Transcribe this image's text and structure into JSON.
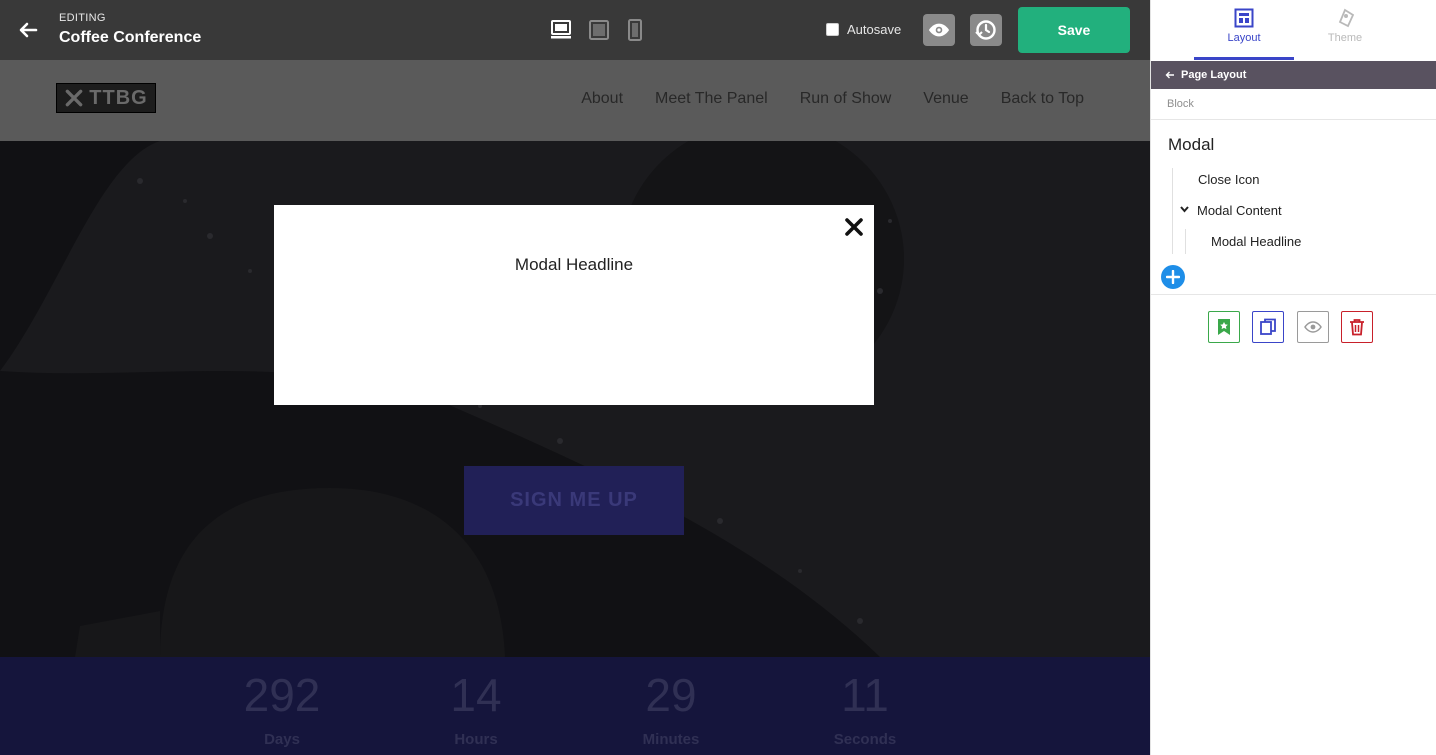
{
  "editor": {
    "status_label": "EDITING",
    "document_title": "Coffee Conference",
    "autosave_label": "Autosave",
    "save_label": "Save"
  },
  "site": {
    "logo_text": "TTBG",
    "nav": [
      "About",
      "Meet The Panel",
      "Run of Show",
      "Venue",
      "Back to Top"
    ],
    "cta_label": "SIGN ME UP",
    "countdown": [
      {
        "value": "292",
        "label": "Days"
      },
      {
        "value": "14",
        "label": "Hours"
      },
      {
        "value": "29",
        "label": "Minutes"
      },
      {
        "value": "11",
        "label": "Seconds"
      }
    ]
  },
  "modal": {
    "headline": "Modal Headline"
  },
  "panel": {
    "tabs": [
      {
        "label": "Layout",
        "icon": "layout-icon",
        "active": true
      },
      {
        "label": "Theme",
        "icon": "theme-icon",
        "active": false
      }
    ],
    "breadcrumb": "Page Layout",
    "section_label": "Block",
    "tree": {
      "root": "Modal",
      "items": [
        "Close Icon",
        "Modal Content",
        "Modal Headline"
      ]
    }
  },
  "colors": {
    "accent": "#3a45c8",
    "save": "#22b07d",
    "add": "#1e8ee8",
    "bookmark": "#3aa84a",
    "copy": "#3a45c8",
    "delete": "#c8202a"
  }
}
